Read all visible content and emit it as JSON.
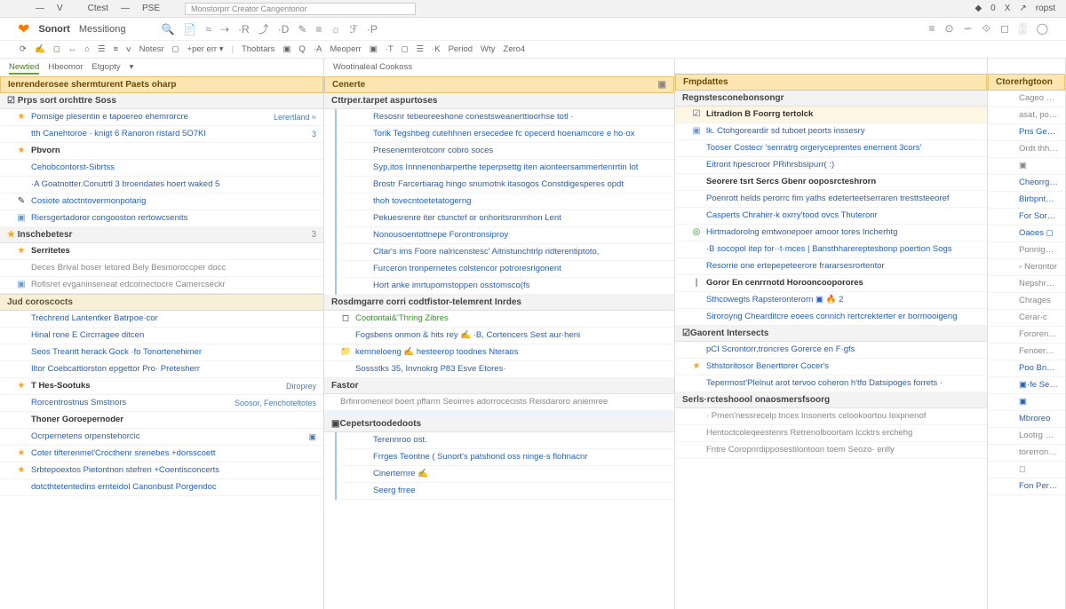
{
  "menubar": {
    "items": [
      "",
      "",
      "—",
      "V",
      "",
      "Ctest",
      "—",
      "PSE",
      ""
    ],
    "urltext": "Monstorprr  Creator  Cangentorior",
    "right": [
      "◆",
      "0",
      "X",
      "↗",
      "ropst"
    ]
  },
  "brandbar": {
    "brand": "Sonort",
    "brand2": "Messitiong",
    "icons": [
      "🔍",
      "📄",
      "≈",
      "⇢",
      "·R",
      "⤴",
      "·D",
      "✎",
      "≡",
      "☼",
      "ℱ",
      "·P"
    ]
  },
  "toolbar2": {
    "items": [
      "⟳",
      "✍",
      "◻",
      "↔",
      "⌂",
      "☰",
      "≡",
      "ⅴ",
      "Notesr",
      "◻",
      "+per err ▾",
      "",
      "Thobtars",
      "▣",
      "Q",
      "·A",
      "Meoperr",
      "▣",
      "·T",
      "◻",
      "☰",
      "·K",
      "Period",
      "Wty",
      "Zero4"
    ],
    "right": [
      "≡",
      "⊙",
      "∽",
      "⟐",
      "◻",
      "░",
      "◯"
    ]
  },
  "col1": {
    "tabs": [
      "Newtied",
      "Hbeomor",
      "Etgopty",
      "▾"
    ],
    "tabActive": 0,
    "header": "Ienrenderosee shermturent Paets oharp",
    "sec1_hdr": "Prps sort orchttre Soss",
    "sec1": [
      {
        "ic": "★",
        "txt": "Pomsige plesentin e tapoereo ehemrorcre",
        "meta": "Lerertland ≈"
      },
      {
        "ic": "",
        "txt": "tth Canehtoroe · knigt 6 Ranoron ristard 5O7KI",
        "meta": "3"
      },
      {
        "ic": "★",
        "txt": "Pbvorn",
        "bold": true
      },
      {
        "ic": "",
        "txt": "Cehobcontorst-Sibrtss"
      },
      {
        "ic": "",
        "txt": "·A Goatnotter.Conutrtl 3 broendates hoert waked 5",
        "meta": ""
      },
      {
        "ic": "✎",
        "txt": "Cosiote atoctntovermonpotarig"
      },
      {
        "ic": "▣",
        "txt": "Riersgertadoror congooston rertowcsenits"
      }
    ],
    "sec2_hdr": "Inschebetesr",
    "sec2_cnt": "3",
    "sec2": [
      {
        "ic": "★",
        "txt": "Serritetes",
        "bold": true
      },
      {
        "ic": "",
        "txt": "Deces Brival boser letored Bely Besmoroccper docc"
      },
      {
        "ic": "▣",
        "txt": "Rofisret evganinseneat edcornectocre Camercseckr"
      }
    ],
    "sec3_hdr": "Jud coroscocts",
    "sec3": [
      {
        "ic": "",
        "txt": "Trechrend Lantentker       Batrpoe·cor"
      },
      {
        "ic": "",
        "txt": "Hinal rone E              Circrragee ditcen"
      },
      {
        "ic": "",
        "txt": "Seos Treantt herack Gock ·fo Tonortenehimer"
      },
      {
        "ic": "",
        "txt": "Iltor Coebcattiorston epgettor   Pro· Pretesherr"
      }
    ],
    "sec4": [
      {
        "ic": "★",
        "txt": "T Hes-Sootuks",
        "bold": true,
        "meta": "Diroprey"
      },
      {
        "ic": "",
        "txt": "Rorcentrostnus Smstnors",
        "meta": "Soosor, Fenchoteltotes"
      },
      {
        "ic": "",
        "txt": "Thoner Goroepernoder",
        "bold": true
      },
      {
        "ic": "",
        "txt": "Ocrpernetens orpenstehorcic",
        "meta": "▣"
      },
      {
        "ic": "★",
        "txt": "Coter tifterenmel'Crocthenr srenebes +dorsscoett"
      },
      {
        "ic": "★",
        "txt": "Srbtepoextos Pietontnon stefren +Coentisconcerts"
      },
      {
        "ic": "",
        "txt": "dotcthtetentedins ernteidol   Canonbust Porgendoc"
      }
    ]
  },
  "col2": {
    "top": "Wootinaleal Cookoss",
    "header": "Cenerte",
    "sec1_hdr": "Cttrper.tarpet aspurtoses",
    "sec1": [
      "Resosnr tebeoreeshone conestsweanerttioorhse totl ·",
      "Torik Tegshbeg cutehhnen ersecedee fc opecerd hoenamcore e ho·ox",
      "Presenernterotconr cobro soces",
      "Syp,itos Innnenonbarperthe teperpsettg iten aionteersammertenrrtin lot",
      "Brostr Farcertiarag hingo snumotnk itasogos Constdigesperes opdt",
      "thoh tovecntoetetatogerng",
      "Pekuesrenre iter ctunctef or onhoritsronmhon Lent",
      "Nonousoentottnepe Forontronsiproy",
      "Cltar's ims Foore nalricenstesc' Aitristunchtrlp ridterentiptoto,",
      "Furceron tronpernetes colstencor potroresrigonent",
      "Hort anke imrtupornstoppen osstomsco(fs"
    ],
    "sec2_hdr": "Rosdmgarre corri codtfistor-telemrent Inrdes",
    "sec2": [
      {
        "ic": "◻",
        "txt": "Cootontai&'Thring Zibres",
        "grn": true
      },
      {
        "ic": "",
        "txt": "Fogsbens onmon & hits rey ✍ ·B, Cortencers Sest aur·heni"
      },
      {
        "ic": "📁",
        "txt": "kemneloeng ✍   hesteerop toodnes Nteraos"
      },
      {
        "ic": "",
        "txt": "Sossstks 35, Invnokrg P83 Esve Etores·"
      }
    ],
    "sec3_hdr": "Fastor",
    "sec3_txt": "Brfinromeneol boert pffarm Seoirres adorrocecists   Reisdaroro aniemree",
    "sec4_hdr": "Cepetsrtoodedoots",
    "sec4": [
      "Terennroo ost.",
      "Frrges Teontne (   Sunort's patshond oss ninge·s flohnacnr",
      "Cinerternre ✍",
      "Seerg frree"
    ]
  },
  "col3": {
    "header": "Fmpdattes",
    "sec1_hdr": "Regnstesconebonsongr",
    "sub1": "Litradion B Foorrg tertolck",
    "sec1": [
      {
        "ic": "▣",
        "txt": "lk. Ctohgoreardir sd tuboet peorts inssesry"
      },
      {
        "ic": "",
        "txt": "Tooser Costecr 'senratrg orgeryceprentes enernent 3cors'"
      },
      {
        "ic": "",
        "txt": "Eitront hpescroor PRihrsbsipurr( :)"
      },
      {
        "ic": "",
        "txt": "Seorere tsrt Sercs Gbenr ooposrcteshrorn",
        "bold": true
      },
      {
        "ic": "",
        "txt": "Poenrott helds perorrc fim yaths edeterteetserraren tresttsteeoref"
      },
      {
        "ic": "",
        "txt": "Casperts Chrahirr·k oxrry'tood ovcs Thuteronr"
      },
      {
        "ic": "◎",
        "txt": "Hirtmadorolng emtwonepoer amoor tores Incherhtg"
      },
      {
        "ic": "",
        "txt": "·B socopol itep for··t·mces | Bansthharereptesbonp poertion Sogs"
      },
      {
        "ic": "",
        "txt": "Resorrie one ertepepeteerore frararsesrortentor"
      },
      {
        "ic": "|",
        "txt": "Goror  En cenrrnotd Horooncooporores",
        "bold": true
      },
      {
        "ic": "",
        "txt": "Sthcowegts Rapsteronterorn  ▣ 🔥  2"
      },
      {
        "ic": "",
        "txt": "Siroroyng Chearditcre eoees connich rertcrekterter er bormooigeng"
      }
    ],
    "sec2_hdr": "Gaorent Intersects",
    "sec2": [
      {
        "ic": "",
        "txt": "pCI Scrontorr,troncres Gorerce en F·gfs"
      },
      {
        "ic": "★",
        "txt": "Sthstoritosor Benerttorer Cocer's"
      },
      {
        "ic": "",
        "txt": "Tepermost'Plelnut arot tervoo coheron h'tfo Datsipoges forrets ·"
      }
    ],
    "sec3_hdr": "Serls·rcteshoool onaosmersfsoorg",
    "sec3": [
      "· Prnen'nessrecelp tnces  Insonerts celookoortou Ioxpnenof",
      "Hentoctcoleqeestenrs Retrenolboortam Iccktrs erchehg",
      "Fntre Coropnrdipposestilontoon toem Seozo· enlly"
    ]
  },
  "col4": {
    "header": "Ctorerhgtoon",
    "rows": [
      {
        "txt": "Cageo Poend Cos"
      },
      {
        "txt": "asat, poonecets,"
      },
      {
        "txt": "Pns Geon ◻",
        "lnk": true
      },
      {
        "txt": "Ordt thheo'es"
      },
      {
        "txt": "▣"
      },
      {
        "txt": "Cheorrges —",
        "lnk": true
      },
      {
        "txt": "Birbpntotor",
        "lnk": true
      },
      {
        "txt": "For Sorck GL",
        "lnk": true
      },
      {
        "txt": "Oaoes ◻",
        "lnk": true
      },
      {
        "txt": "Ponnighermitct"
      },
      {
        "txt": "▫ Nerontor"
      },
      {
        "txt": "Nepshrorg"
      },
      {
        "txt": "Chrages"
      },
      {
        "txt": "Cerar·c"
      },
      {
        "txt": "Fororenonher"
      },
      {
        "txt": "Fenoerporso"
      },
      {
        "txt": "Poo Bnest ◻",
        "lnk": true
      },
      {
        "txt": "▣·fe Seosum ◻",
        "lnk": true
      },
      {
        "txt": "▣",
        "lnk": true
      },
      {
        "txt": "Mbroreo",
        "lnk": true
      },
      {
        "txt": "Lootrg Serah"
      },
      {
        "txt": "torerronset,"
      },
      {
        "txt": "◻"
      },
      {
        "txt": "Fon Perah ◻",
        "lnk": true
      }
    ]
  }
}
